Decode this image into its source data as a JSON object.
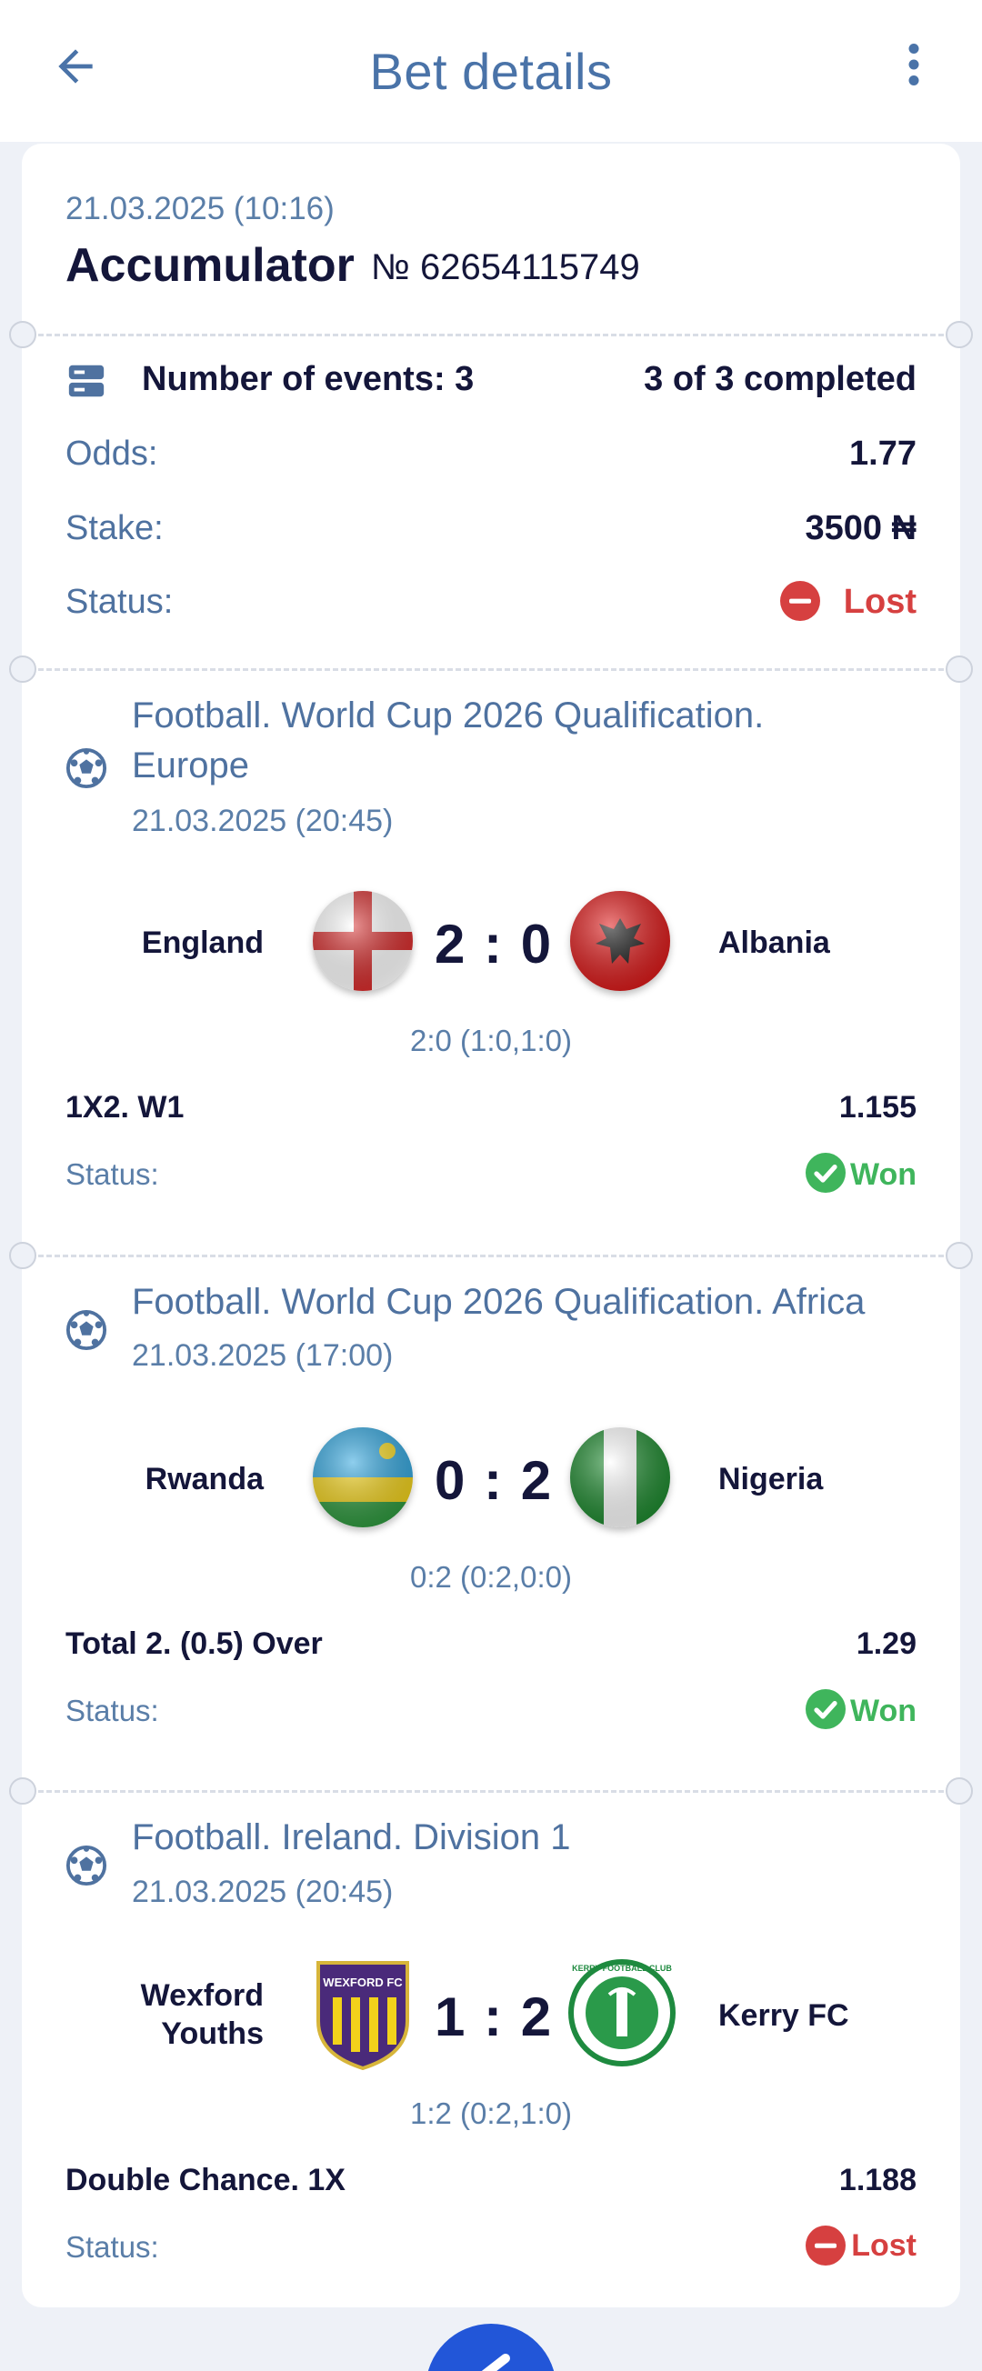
{
  "header": {
    "title": "Bet details"
  },
  "bet": {
    "date": "21.03.2025 (10:16)",
    "type": "Accumulator",
    "number": "№ 62654115749",
    "events_label": "Number of events: 3",
    "completed": "3 of 3 completed",
    "odds_label": "Odds:",
    "odds": "1.77",
    "stake_label": "Stake:",
    "stake": "3500 ₦",
    "status_label": "Status:",
    "status": "Lost"
  },
  "events": [
    {
      "title": "Football. World Cup 2026 Qualification. Europe",
      "title_line1": "Football. World Cup 2026 Qualification.",
      "title_line2": "Europe",
      "date": "21.03.2025 (20:45)",
      "home": "England",
      "away": "Albania",
      "score": "2 : 0",
      "detail": "2:0 (1:0,1:0)",
      "market": "1X2. W1",
      "coef": "1.155",
      "status_label": "Status:",
      "status": "Won"
    },
    {
      "title": "Football. World Cup 2026 Qualification. Africa",
      "date": "21.03.2025 (17:00)",
      "home": "Rwanda",
      "away": "Nigeria",
      "score": "0 : 2",
      "detail": "0:2 (0:2,0:0)",
      "market": "Total 2. (0.5) Over",
      "coef": "1.29",
      "status_label": "Status:",
      "status": "Won"
    },
    {
      "title": "Football. Ireland. Division 1",
      "date": "21.03.2025 (20:45)",
      "home_line1": "Wexford",
      "home_line2": "Youths",
      "away": "Kerry FC",
      "score": "1 : 2",
      "detail": "1:2 (0:2,1:0)",
      "market": "Double Chance. 1X",
      "coef": "1.188",
      "status_label": "Status:",
      "status": "Lost",
      "home_logo_text": "WEXFORD FC",
      "away_logo_text": "KERRY FOOTBALL CLUB"
    }
  ],
  "colors": {
    "accent": "#4a73a8",
    "won": "#3fb55c",
    "lost": "#d64040",
    "fab": "#2256d8"
  },
  "icons": [
    "back-arrow-icon",
    "more-vertical-icon",
    "events-list-icon",
    "football-icon",
    "status-lost-icon",
    "status-won-icon"
  ]
}
